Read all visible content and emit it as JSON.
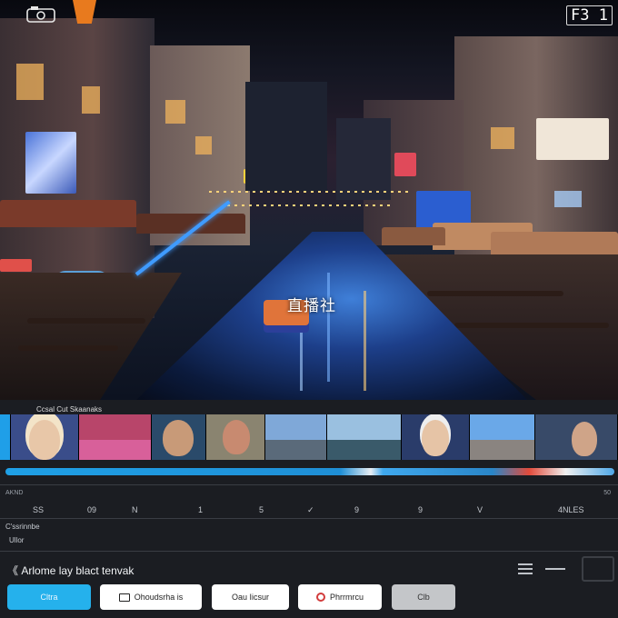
{
  "preview": {
    "overlay_text": "直播社",
    "counter": "F3 1"
  },
  "timeline": {
    "track_label": "Ccsal Cut Skaanaks",
    "ruler_label": "AKND",
    "ruler_right": "50",
    "ticks": [
      "SS",
      "09",
      "N",
      "1",
      "5",
      "✓",
      "9",
      "9",
      "V",
      "4NLES"
    ],
    "layer_label": "C'ssrinnbe",
    "layer_sub": "Ullor"
  },
  "status": {
    "text": "Arlome lay blact tenvak"
  },
  "buttons": {
    "primary": "Cltra",
    "second": "Ohoudsrha is",
    "third": "Oau Iicsur",
    "fourth": "Phrrmrcu",
    "fifth": "Clb"
  },
  "icons": {
    "status_icon": "chevron-left-icon",
    "menu": "menu-icon",
    "camera": "camera-icon"
  },
  "colors": {
    "accent": "#25b1ec",
    "playbar_marker": "#e24b3b"
  }
}
